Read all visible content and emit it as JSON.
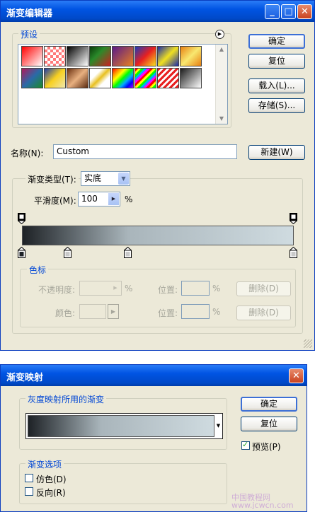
{
  "editor": {
    "title": "渐变编辑器",
    "presets_label": "预设",
    "ok": "确定",
    "reset": "复位",
    "load": "载入(L)...",
    "save": "存储(S)...",
    "name_label": "名称(N):",
    "name_value": "Custom",
    "new_button": "新建(W)",
    "type_label": "渐变类型(T):",
    "type_value": "实底",
    "smooth_label": "平滑度(M):",
    "smooth_value": "100",
    "percent": "%",
    "stops_label": "色标",
    "opacity_label": "不透明度:",
    "color_label": "颜色:",
    "position_label": "位置:",
    "delete_label": "删除(D)",
    "gradient_colors": [
      "#1e2226",
      "#596166",
      "#a9b5bb",
      "#cfdbe0"
    ],
    "color_stop_positions": [
      0,
      0.17,
      0.39,
      1.0
    ]
  },
  "gradient_map": {
    "title": "渐变映射",
    "group_label": "灰度映射所用的渐变",
    "ok": "确定",
    "reset": "复位",
    "preview_label": "预览(P)",
    "preview_checked": true,
    "options_label": "渐变选项",
    "dither_label": "仿色(D)",
    "reverse_label": "反向(R)",
    "watermark": "中国教程网 www.jcwcn.com"
  },
  "presets": [
    "linear-gradient(135deg,#ff0000,#ffffff)",
    "repeating-conic-gradient(#ff7a7a 0 25%,#ffffff 0 50%) 0 0/8px 8px",
    "linear-gradient(135deg,#000000,#ffffff)",
    "linear-gradient(135deg,#0a3a0a,#2a8a2a 40%,#cc2020)",
    "linear-gradient(135deg,#5a1a8a,#e88020)",
    "linear-gradient(135deg,#1a3ab8,#e82020 50%,#f8e020)",
    "linear-gradient(135deg,#1a2aa8,#f0e020 50%,#1a2aa8)",
    "linear-gradient(135deg,#e88010,#f8e870 50%,#e88010)",
    "linear-gradient(135deg,#b01a5a,#2a6aa8 50%,#1a8a2a)",
    "linear-gradient(135deg,#1a3aa8,#f8d020 50%,#f0e8b0)",
    "linear-gradient(135deg,#6a3010,#e8b080 50%,#5a2a10)",
    "linear-gradient(135deg,#ffffff 30%,#e8c020 50%,#ffffff 70%)",
    "linear-gradient(135deg,#ff0000,#ff8800,#ffff00,#00ff00,#00aaff,#0000ff,#aa00ff)",
    "repeating-linear-gradient(135deg,#ff0000 0 3px,#ffff00 3px 6px,#00ff00 6px 9px,#00aaff 9px 12px,#ff00ff 12px 15px)",
    "repeating-linear-gradient(135deg,#e82020 0 3px,#ffffff 3px 6px)",
    "linear-gradient(135deg,#1a1a1a,#ffffff)"
  ]
}
